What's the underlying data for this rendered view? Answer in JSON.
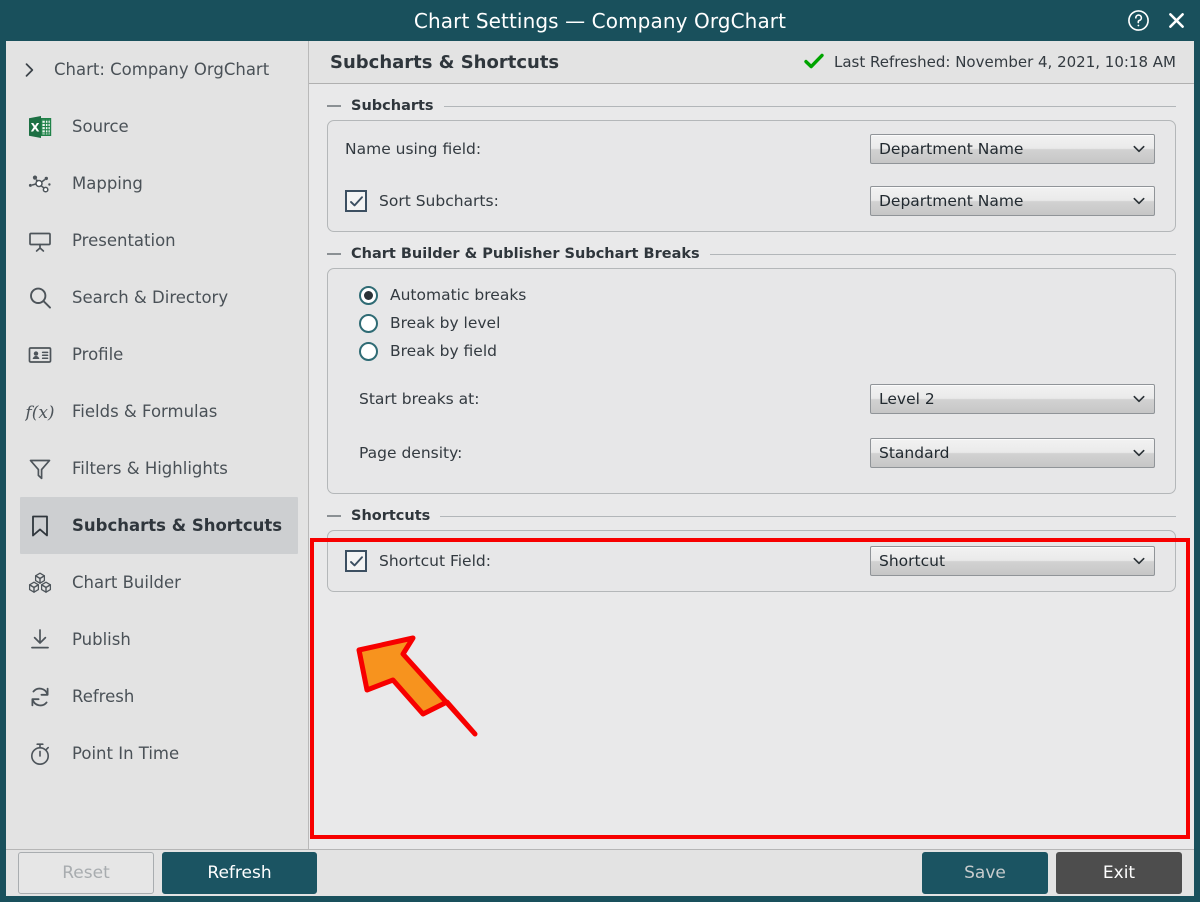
{
  "window": {
    "title": "Chart Settings — Company OrgChart",
    "help_icon": "help-circle-icon",
    "close_icon": "close-icon"
  },
  "sidebar": {
    "chart_row": {
      "icon": "chevron-right-icon",
      "label": "Chart: Company OrgChart"
    },
    "items": [
      {
        "label": "Source",
        "icon": "excel-file-icon",
        "active": false
      },
      {
        "label": "Mapping",
        "icon": "node-graph-icon",
        "active": false
      },
      {
        "label": "Presentation",
        "icon": "presentation-screen-icon",
        "active": false
      },
      {
        "label": "Search & Directory",
        "icon": "magnifier-icon",
        "active": false
      },
      {
        "label": "Profile",
        "icon": "id-card-icon",
        "active": false
      },
      {
        "label": "Fields & Formulas",
        "icon": "function-fx-icon",
        "active": false
      },
      {
        "label": "Filters & Highlights",
        "icon": "funnel-icon",
        "active": false
      },
      {
        "label": "Subcharts & Shortcuts",
        "icon": "bookmark-icon",
        "active": true
      },
      {
        "label": "Chart Builder",
        "icon": "blocks-icon",
        "active": false
      },
      {
        "label": "Publish",
        "icon": "download-tray-icon",
        "active": false
      },
      {
        "label": "Refresh",
        "icon": "refresh-cycle-icon",
        "active": false
      },
      {
        "label": "Point In Time",
        "icon": "stopwatch-icon",
        "active": false
      }
    ]
  },
  "main": {
    "title": "Subcharts & Shortcuts",
    "status": {
      "icon": "green-check-icon",
      "text": "Last Refreshed: November 4, 2021, 10:18 AM",
      "color": "#00a000"
    },
    "groups": {
      "subcharts": {
        "legend": "Subcharts",
        "name_using_field": {
          "label": "Name using field:",
          "value": "Department Name"
        },
        "sort_subcharts": {
          "label": "Sort Subcharts:",
          "checked": true,
          "value": "Department Name"
        }
      },
      "breaks": {
        "legend": "Chart Builder & Publisher Subchart Breaks",
        "radios": [
          {
            "label": "Automatic breaks",
            "selected": true
          },
          {
            "label": "Break by level",
            "selected": false
          },
          {
            "label": "Break by field",
            "selected": false
          }
        ],
        "start_breaks_at": {
          "label": "Start breaks at:",
          "value": "Level 2"
        },
        "page_density": {
          "label": "Page density:",
          "value": "Standard"
        }
      },
      "shortcuts": {
        "legend": "Shortcuts",
        "shortcut_field": {
          "label": "Shortcut Field:",
          "checked": true,
          "value": "Shortcut"
        },
        "highlight_color": "#f70000"
      }
    }
  },
  "annotation": {
    "arrow_icon": "arrow-pointer-up-left",
    "fill_color": "#F7931E",
    "stroke_color": "#F70000"
  },
  "footer": {
    "reset_label": "Reset",
    "refresh_label": "Refresh",
    "save_label": "Save",
    "exit_label": "Exit"
  },
  "colors": {
    "titlebar": "#19505c",
    "accent": "#1b5462",
    "panel": "#e9e9ea",
    "sidebar": "#e3e3e3"
  }
}
